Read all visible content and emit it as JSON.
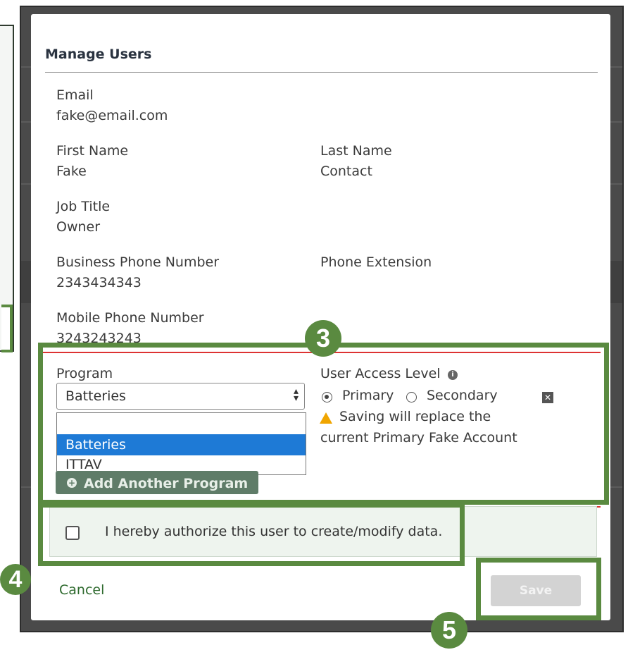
{
  "modal": {
    "title": "Manage Users",
    "email": {
      "label": "Email",
      "value": "fake@email.com"
    },
    "first_name": {
      "label": "First Name",
      "value": "Fake"
    },
    "last_name": {
      "label": "Last Name",
      "value": "Contact"
    },
    "job_title": {
      "label": "Job Title",
      "value": "Owner"
    },
    "business_phone": {
      "label": "Business Phone Number",
      "value": "2343434343"
    },
    "phone_extension": {
      "label": "Phone Extension",
      "value": ""
    },
    "mobile_phone": {
      "label": "Mobile Phone Number",
      "value": "3243243243"
    },
    "program": {
      "label": "Program",
      "selected": "Batteries",
      "options": [
        "",
        "Batteries",
        "ITTAV"
      ],
      "add_button": "Add Another Program"
    },
    "access": {
      "label": "User Access Level",
      "primary": "Primary",
      "secondary": "Secondary",
      "selected": "Primary",
      "warning_line1": "Saving will replace the",
      "warning_line2": "current Primary Fake Account"
    },
    "consent": "I hereby authorize this user to create/modify data.",
    "cancel": "Cancel",
    "save": "Save"
  },
  "callouts": {
    "step3": "3",
    "step4": "4",
    "step5": "5"
  },
  "colors": {
    "callout": "#5a8a40",
    "selected_option": "#1e7ad6",
    "link": "#2e6a2e"
  }
}
